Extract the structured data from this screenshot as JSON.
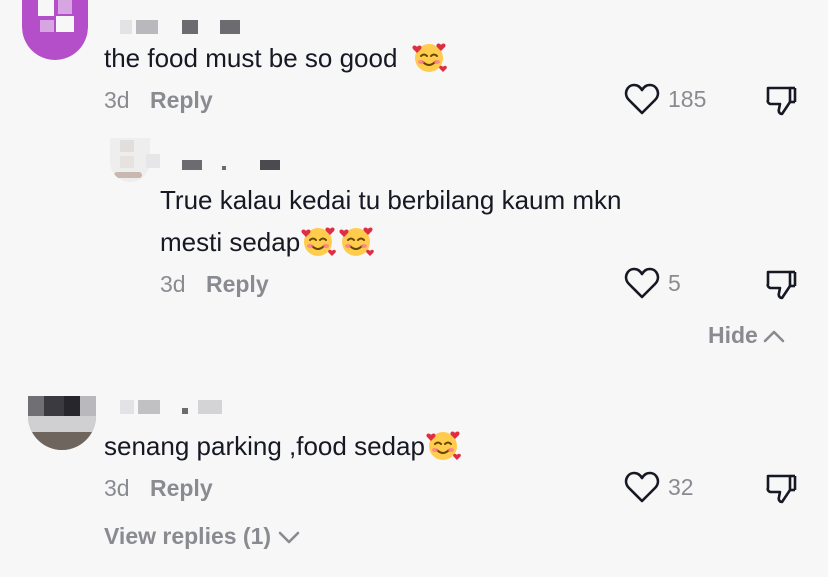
{
  "comments": [
    {
      "text": "the food must be so good",
      "time": "3d",
      "reply_label": "Reply",
      "likes": "185",
      "emoji_count": 1
    },
    {
      "text_line1": "True kalau kedai tu berbilang kaum mkn",
      "text_line2": "mesti sedap",
      "time": "3d",
      "reply_label": "Reply",
      "likes": "5",
      "emoji_count": 2
    },
    {
      "text": "senang parking ,food sedap",
      "time": "3d",
      "reply_label": "Reply",
      "likes": "32",
      "emoji_count": 1
    }
  ],
  "hide_label": "Hide",
  "view_replies_label": "View replies (1)",
  "icons": {
    "like": "heart-outline-icon",
    "dislike": "thumbs-down-icon",
    "emoji": "smiling-face-with-hearts-emoji",
    "hide_chevron": "chevron-up-icon",
    "view_chevron": "chevron-down-icon"
  },
  "colors": {
    "background": "#f7f7f7",
    "text": "#161823",
    "muted": "#8a8b91",
    "avatar1": "#b54fc9"
  }
}
